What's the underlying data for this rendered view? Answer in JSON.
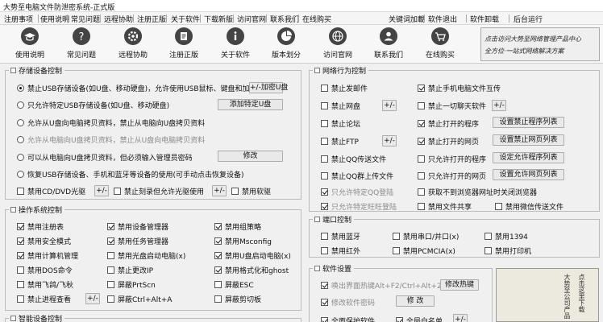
{
  "window": {
    "title": "大势至电脑文件防泄密系统-正式版"
  },
  "menu_left": [
    "注册事项",
    "使用说明",
    "常见问题",
    "远程协助",
    "注册正版",
    "关于软件",
    "下载新版",
    "访问官网",
    "联系我们",
    "在线购买"
  ],
  "menu_right": [
    "关键词加載",
    "软件退出",
    "软件卸载",
    "后台运行"
  ],
  "toolbar": [
    {
      "label": "使用说明",
      "icon": "graduation-cap-icon"
    },
    {
      "label": "常见问题",
      "icon": "question-icon"
    },
    {
      "label": "远程协助",
      "icon": "remote-gear-icon"
    },
    {
      "label": "注册正版",
      "icon": "register-icon"
    },
    {
      "label": "关于软件",
      "icon": "info-icon"
    },
    {
      "label": "版本划分",
      "icon": "pie-chart-icon"
    },
    {
      "label": "访问官网",
      "icon": "globe-icon"
    },
    {
      "label": "联系我们",
      "icon": "contact-icon"
    },
    {
      "label": "在线购买",
      "icon": "cart-icon"
    }
  ],
  "banner": {
    "line1": "点击访问大势至网络管理产品中心",
    "line2": "全方位·一站式网络解决方案"
  },
  "storage": {
    "title": "存储设备控制",
    "opt1": "禁止USB存储设备(如U盘、移动硬盘)，允许使用USB鼠标、键盘和加密狗",
    "btn_ukey": "+/-加密U盘",
    "opt2": "只允许特定USB存储设备(如U盘、移动硬盘)",
    "btn_add_u": "添加特定U盘",
    "opt3": "允许从U盘向电脑拷贝资料，禁止从电脑向U盘拷贝资料",
    "opt4": "允许从电脑向U盘拷贝资料，禁止从U盘向电脑拷贝资料",
    "opt5": "可以从电脑向U盘拷贝资料，但必须输入管理员密码",
    "btn_modify": "修改",
    "opt6": "恢复USB存储设备、手机和蓝牙等设备的使用(可手动点击恢复设备)",
    "cd": "禁用CD/DVD光驱",
    "burn": "禁止刻录但允许光驱使用",
    "floppy": "禁用软驱",
    "pm": "+/-"
  },
  "ops": {
    "title": "操作系统控制",
    "items": [
      "禁用注册表",
      "禁用设备管理器",
      "禁用组策略",
      "禁用安全模式",
      "禁用任务管理器",
      "禁用Msconfig",
      "禁用计算机管理",
      "禁用光盘启动电脑(x)",
      "禁用U盘启动电脑(x)",
      "禁用DOS命令",
      "禁止更改IP",
      "禁用格式化和ghost",
      "禁用飞鸽/飞秋",
      "屏蔽PrtScn",
      "屏蔽ESC",
      "禁止进程查看",
      "屏蔽Ctrl+Alt+A",
      "屏蔽剪切板"
    ],
    "btn_pm": "+/-"
  },
  "smart": {
    "title": "智能设备控制"
  },
  "net": {
    "title": "网络行为控制",
    "left": [
      "禁止发邮件",
      "禁止网盘",
      "禁止论坛",
      "禁止FTP",
      "禁止QQ传送文件",
      "禁止QQ群上传文件",
      "只允许特定QQ登陆",
      "只允许特定旺旺登陆"
    ],
    "right": [
      "禁止手机电脑文件互传",
      "禁止一切聊天软件",
      "禁止打开的程序",
      "禁止打开的网页",
      "只允许打开的程序",
      "只允许打开的网页",
      "获取不到浏览器网址时关闭浏览器",
      "禁用文件共享",
      "禁用微信传送文件"
    ],
    "btn_pm": "+/-",
    "btn_prog": "设置禁止程序列表",
    "btn_web": "设置禁止网页列表",
    "btn_allow_prog": "设定允许程序列表",
    "btn_allow_web": "设置允许网页列表"
  },
  "port": {
    "title": "端口控制",
    "items": [
      "禁用蓝牙",
      "禁用串口/并口(x)",
      "禁用1394",
      "禁用红外",
      "禁用PCMCIA(x)",
      "禁用打印机"
    ]
  },
  "software": {
    "title": "软件设置",
    "hotkey": "唤出界面热键Alt+F2/Ctrl+Alt+2",
    "btn_hotkey": "修改热键",
    "pwd": "修改软件密码",
    "btn_pwd": "修 改",
    "protect": "全面保护软件",
    "whitelist": "全局白名单",
    "btn_pm": "+/-"
  },
  "side_ink": {
    "text1": "点击这里下载",
    "text2": "大势至公司产品"
  }
}
